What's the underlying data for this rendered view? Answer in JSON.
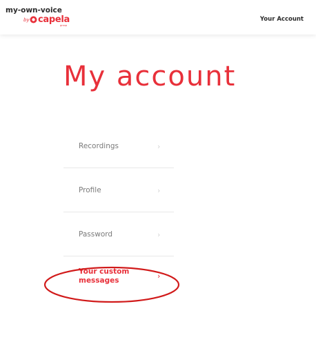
{
  "header": {
    "logo_name": "my-own-voice",
    "logo_by": "by",
    "logo_brand": "capela",
    "logo_tagline": "group",
    "account_link": "Your Account"
  },
  "main": {
    "title": "My account",
    "menu": [
      {
        "label": "Recordings",
        "chevron": "›"
      },
      {
        "label": "Profile",
        "chevron": "›"
      },
      {
        "label": "Password",
        "chevron": "›"
      },
      {
        "label": "Your custom messages",
        "chevron": "›",
        "active": true
      }
    ]
  },
  "colors": {
    "accent": "#e8303a",
    "annotation": "#d11a1a",
    "text_dark": "#2b2b2b",
    "text_muted": "#7a7a7a",
    "divider": "#e8e8e8"
  },
  "icons": {
    "brand": "acapela-logo-icon",
    "chevron": "chevron-right-icon"
  }
}
